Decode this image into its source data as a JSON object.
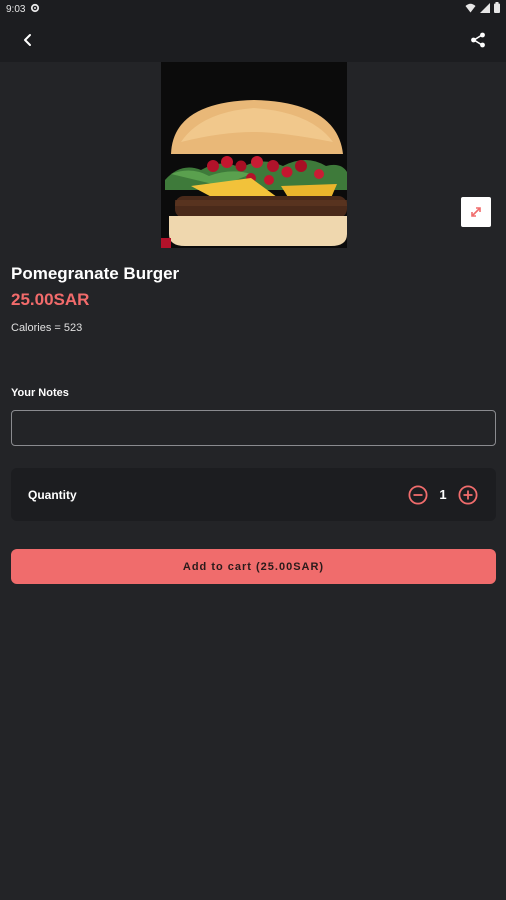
{
  "status_bar": {
    "time": "9:03",
    "icons": [
      "settings-icon",
      "wifi-icon",
      "signal-icon",
      "battery-icon"
    ]
  },
  "app_bar": {
    "back_icon": "chevron-left-icon",
    "share_icon": "share-icon"
  },
  "product": {
    "name": "Pomegranate Burger",
    "price": "25.00SAR",
    "calories": "Calories = 523",
    "image": "burger-photo",
    "expand_icon": "expand-icon"
  },
  "notes": {
    "label": "Your Notes",
    "value": "",
    "placeholder": ""
  },
  "quantity": {
    "label": "Quantity",
    "value": "1",
    "minus_icon": "minus-circle-icon",
    "plus_icon": "plus-circle-icon"
  },
  "cart": {
    "button_label": "Add to cart (25.00SAR)"
  },
  "colors": {
    "accent": "#f06c6c",
    "background": "#232427",
    "surface": "#1c1d20"
  }
}
